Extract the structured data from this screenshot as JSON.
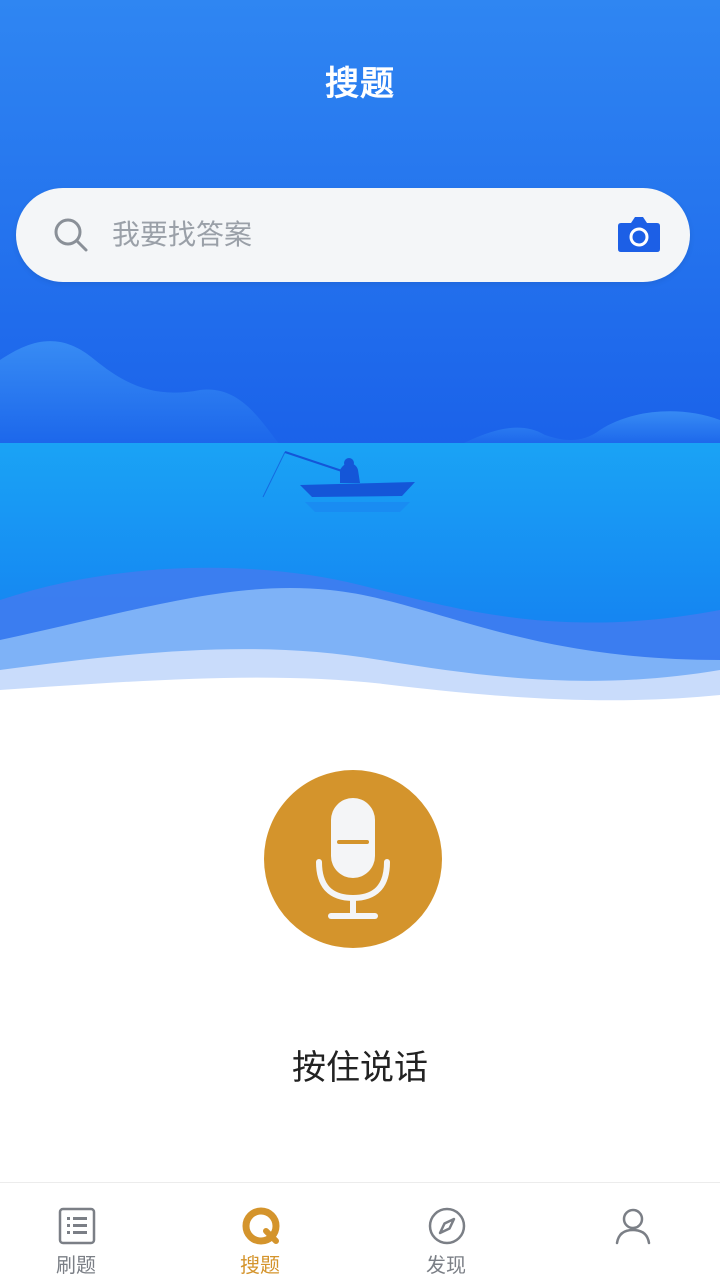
{
  "header": {
    "title": "搜题"
  },
  "search": {
    "placeholder": "我要找答案"
  },
  "voice": {
    "label": "按住说话"
  },
  "tabs": [
    {
      "label": "刷题",
      "icon": "list-icon",
      "active": false
    },
    {
      "label": "搜题",
      "icon": "search-tab-icon",
      "active": true
    },
    {
      "label": "发现",
      "icon": "compass-icon",
      "active": false
    },
    {
      "label": "",
      "icon": "profile-icon",
      "active": false
    }
  ],
  "colors": {
    "accent": "#d4942c",
    "brand_blue": "#1f6ff0",
    "tab_inactive": "#7b7f86"
  }
}
